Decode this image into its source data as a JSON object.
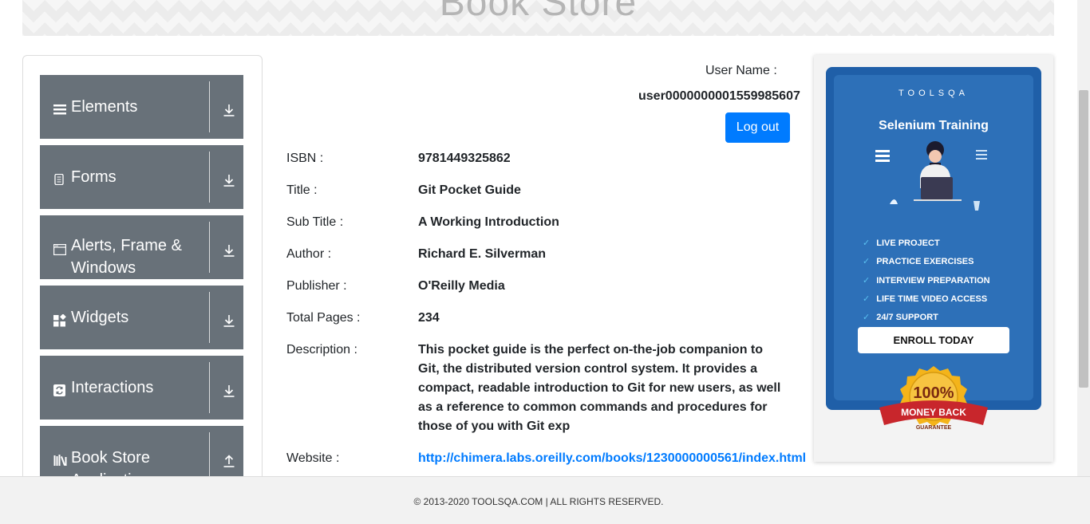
{
  "banner": {
    "title": "Book Store"
  },
  "sidebar": {
    "groups": [
      {
        "label": "Elements",
        "icon": "hamburger-icon"
      },
      {
        "label": "Forms",
        "icon": "document-icon"
      },
      {
        "label": "Alerts, Frame & Windows",
        "icon": "window-icon"
      },
      {
        "label": "Widgets",
        "icon": "grid-icon"
      },
      {
        "label": "Interactions",
        "icon": "refresh-icon"
      },
      {
        "label": "Book Store Application",
        "icon": "books-icon"
      }
    ]
  },
  "user": {
    "label": "User Name :",
    "value": "user0000000001559985607",
    "logout_label": "Log out"
  },
  "book": {
    "isbn_label": "ISBN :",
    "isbn": "9781449325862",
    "title_label": "Title :",
    "title": "Git Pocket Guide",
    "subtitle_label": "Sub Title :",
    "subtitle": "A Working Introduction",
    "author_label": "Author :",
    "author": "Richard E. Silverman",
    "publisher_label": "Publisher :",
    "publisher": "O'Reilly Media",
    "pages_label": "Total Pages :",
    "pages": "234",
    "description_label": "Description :",
    "description": "This pocket guide is the perfect on-the-job companion to Git, the distributed version control system. It provides a compact, readable introduction to Git for new users, as well as a reference to common commands and procedures for those of you with Git exp",
    "website_label": "Website :",
    "website": "http://chimera.labs.oreilly.com/books/1230000000561/index.html"
  },
  "ad": {
    "brand": "TOOLSQA",
    "title": "Selenium Training",
    "items": [
      "LIVE PROJECT",
      "PRACTICE EXERCISES",
      "INTERVIEW PREPARATION",
      "LIFE TIME VIDEO ACCESS",
      "24/7 SUPPORT"
    ],
    "enroll_label": "ENROLL TODAY",
    "badge_percent": "100%",
    "badge_text": "MONEY BACK",
    "badge_sub": "GUARANTEE",
    "colors": {
      "card": "#1f5fa8",
      "accent": "#5bc0f0",
      "badge_ribbon": "#c8262c",
      "badge_gold": "#f4b41a"
    }
  },
  "footer": {
    "text": "© 2013-2020 TOOLSQA.COM | ALL RIGHTS RESERVED."
  },
  "colors": {
    "sidebar_group": "#687179",
    "primary": "#007bff"
  }
}
